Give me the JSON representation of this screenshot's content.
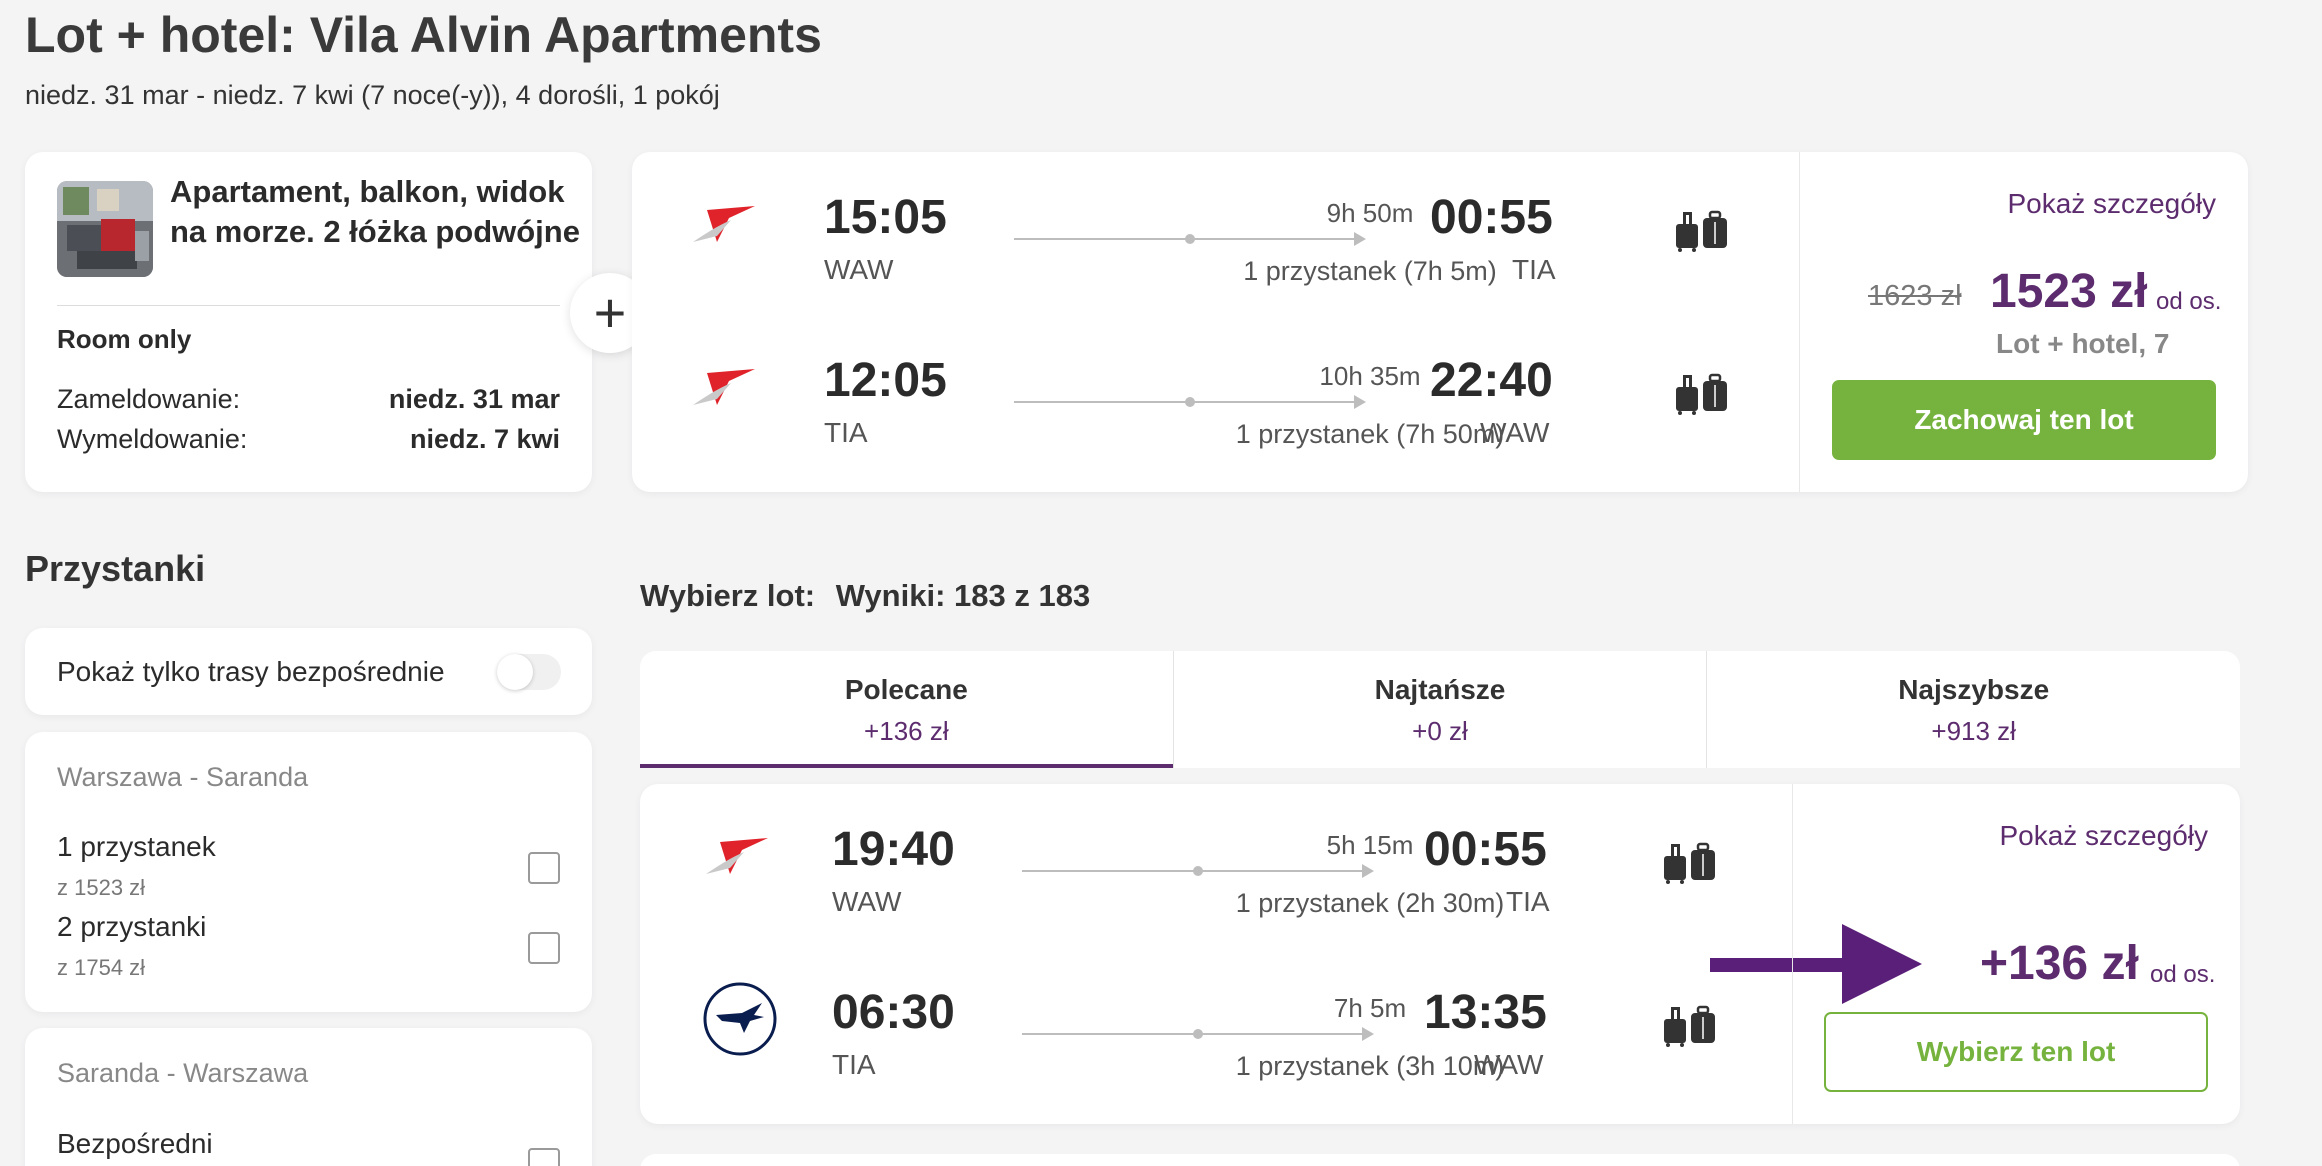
{
  "header": {
    "title": "Lot + hotel: Vila Alvin Apartments",
    "subtitle": "niedz. 31 mar - niedz. 7 kwi (7 noce(-y)),  4 dorośli,  1 pokój"
  },
  "hotel": {
    "room_name": "Apartament, balkon, widok na morze. 2 łóżka podwójne",
    "board": "Room only",
    "checkin_label": "Zameldowanie:",
    "checkin_value": "niedz. 31 mar",
    "checkout_label": "Wymeldowanie:",
    "checkout_value": "niedz. 7 kwi"
  },
  "plus_icon": "+",
  "selected_flight": {
    "outbound": {
      "dep_time": "15:05",
      "dep_code": "WAW",
      "duration": "9h 50m",
      "stops": "1 przystanek (7h 5m)",
      "arr_time": "00:55",
      "arr_code": "TIA",
      "airline_icon": "airline-swoosh-icon"
    },
    "inbound": {
      "dep_time": "12:05",
      "dep_code": "TIA",
      "duration": "10h 35m",
      "stops": "1 przystanek (7h 50m)",
      "arr_time": "22:40",
      "arr_code": "WAW",
      "airline_icon": "airline-swoosh-icon"
    },
    "details_link": "Pokaż szczegóły",
    "old_price": "1623 zł",
    "new_price": "1523 zł",
    "per_person": "od os.",
    "price_note": "Lot + hotel, 7",
    "keep_button": "Zachowaj ten lot"
  },
  "filters": {
    "heading": "Przystanki",
    "direct_only_label": "Pokaż tylko trasy bezpośrednie",
    "groups": [
      {
        "title": "Warszawa - Saranda",
        "options": [
          {
            "label": "1 przystanek",
            "price": "z 1523 zł"
          },
          {
            "label": "2 przystanki",
            "price": "z 1754 zł"
          }
        ]
      },
      {
        "title": "Saranda - Warszawa",
        "options": [
          {
            "label": "Bezpośredni",
            "price": ""
          }
        ]
      }
    ]
  },
  "results": {
    "label": "Wybierz lot:",
    "count": "Wyniki: 183 z 183",
    "tabs": [
      {
        "label": "Polecane",
        "value": "+136 zł",
        "active": true
      },
      {
        "label": "Najtańsze",
        "value": "+0 zł",
        "active": false
      },
      {
        "label": "Najszybsze",
        "value": "+913 zł",
        "active": false
      }
    ],
    "flight": {
      "outbound": {
        "dep_time": "19:40",
        "dep_code": "WAW",
        "duration": "5h 15m",
        "stops": "1 przystanek (2h 30m)",
        "arr_time": "00:55",
        "arr_code": "TIA",
        "airline_icon": "airline-swoosh-icon"
      },
      "inbound": {
        "dep_time": "06:30",
        "dep_code": "TIA",
        "duration": "7h 5m",
        "stops": "1 przystanek (3h 10m)",
        "arr_time": "13:35",
        "arr_code": "WAW",
        "airline_icon": "crane-logo-icon"
      },
      "details_link": "Pokaż szczegóły",
      "price": "+136 zł",
      "per_person": "od os.",
      "select_button": "Wybierz ten lot"
    }
  },
  "colors": {
    "accent_purple": "#5c2c6e",
    "arrow_purple": "#5a2079",
    "green": "#76b33e"
  }
}
